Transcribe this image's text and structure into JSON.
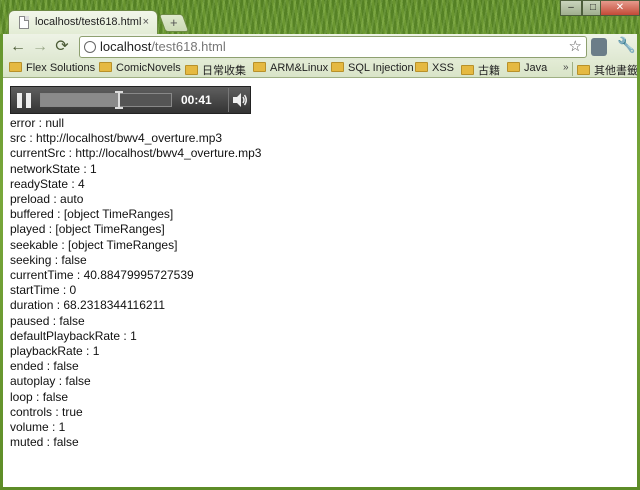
{
  "window": {
    "minimize": "–",
    "maximize": "□",
    "close": "✕"
  },
  "tab": {
    "title": "localhost/test618.html",
    "close_icon": "close-icon",
    "close_glyph": "×"
  },
  "new_tab": {
    "glyph": "+"
  },
  "toolbar": {
    "back_glyph": "←",
    "forward_glyph": "→",
    "reload_glyph": "⟳",
    "url_host": "localhost",
    "url_path": "/test618.html",
    "star_glyph": "☆",
    "wrench_glyph": "🔧"
  },
  "bookmarks": [
    {
      "label": "Flex Solutions"
    },
    {
      "label": "ComicNovels"
    },
    {
      "label": "日常收集"
    },
    {
      "label": "ARM&Linux"
    },
    {
      "label": "SQL Injection"
    },
    {
      "label": "XSS"
    },
    {
      "label": "古籍"
    },
    {
      "label": "Java"
    },
    {
      "label": "其他書籤"
    }
  ],
  "bookmarks_more": "»",
  "player": {
    "time": "00:41",
    "progress": 0.6
  },
  "properties": [
    "error : null",
    "src : http://localhost/bwv4_overture.mp3",
    "currentSrc : http://localhost/bwv4_overture.mp3",
    "networkState : 1",
    "readyState : 4",
    "preload : auto",
    "buffered : [object TimeRanges]",
    "played : [object TimeRanges]",
    "seekable : [object TimeRanges]",
    "seeking : false",
    "currentTime : 40.88479995727539",
    "startTime : 0",
    "duration : 68.2318344116211",
    "paused : false",
    "defaultPlaybackRate : 1",
    "playbackRate : 1",
    "ended : false",
    "autoplay : false",
    "loop : false",
    "controls : true",
    "volume : 1",
    "muted : false"
  ]
}
